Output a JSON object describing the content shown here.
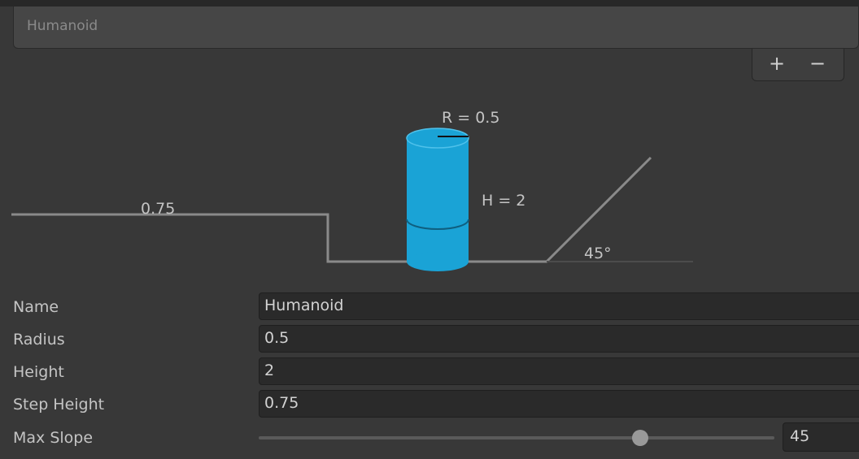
{
  "agent_list": {
    "selected_item": "Humanoid"
  },
  "list_controls": {
    "add_label": "+",
    "remove_label": "−"
  },
  "diagram": {
    "radius_label": "R = 0.5",
    "height_label": "H = 2",
    "step_height_label": "0.75",
    "slope_label": "45°",
    "cylinder_color": "#1aa3d6"
  },
  "properties": {
    "name": {
      "label": "Name",
      "value": "Humanoid"
    },
    "radius": {
      "label": "Radius",
      "value": "0.5"
    },
    "height": {
      "label": "Height",
      "value": "2"
    },
    "step_height": {
      "label": "Step Height",
      "value": "0.75"
    },
    "max_slope": {
      "label": "Max Slope",
      "value": "45",
      "slider_fraction": 0.74
    }
  }
}
